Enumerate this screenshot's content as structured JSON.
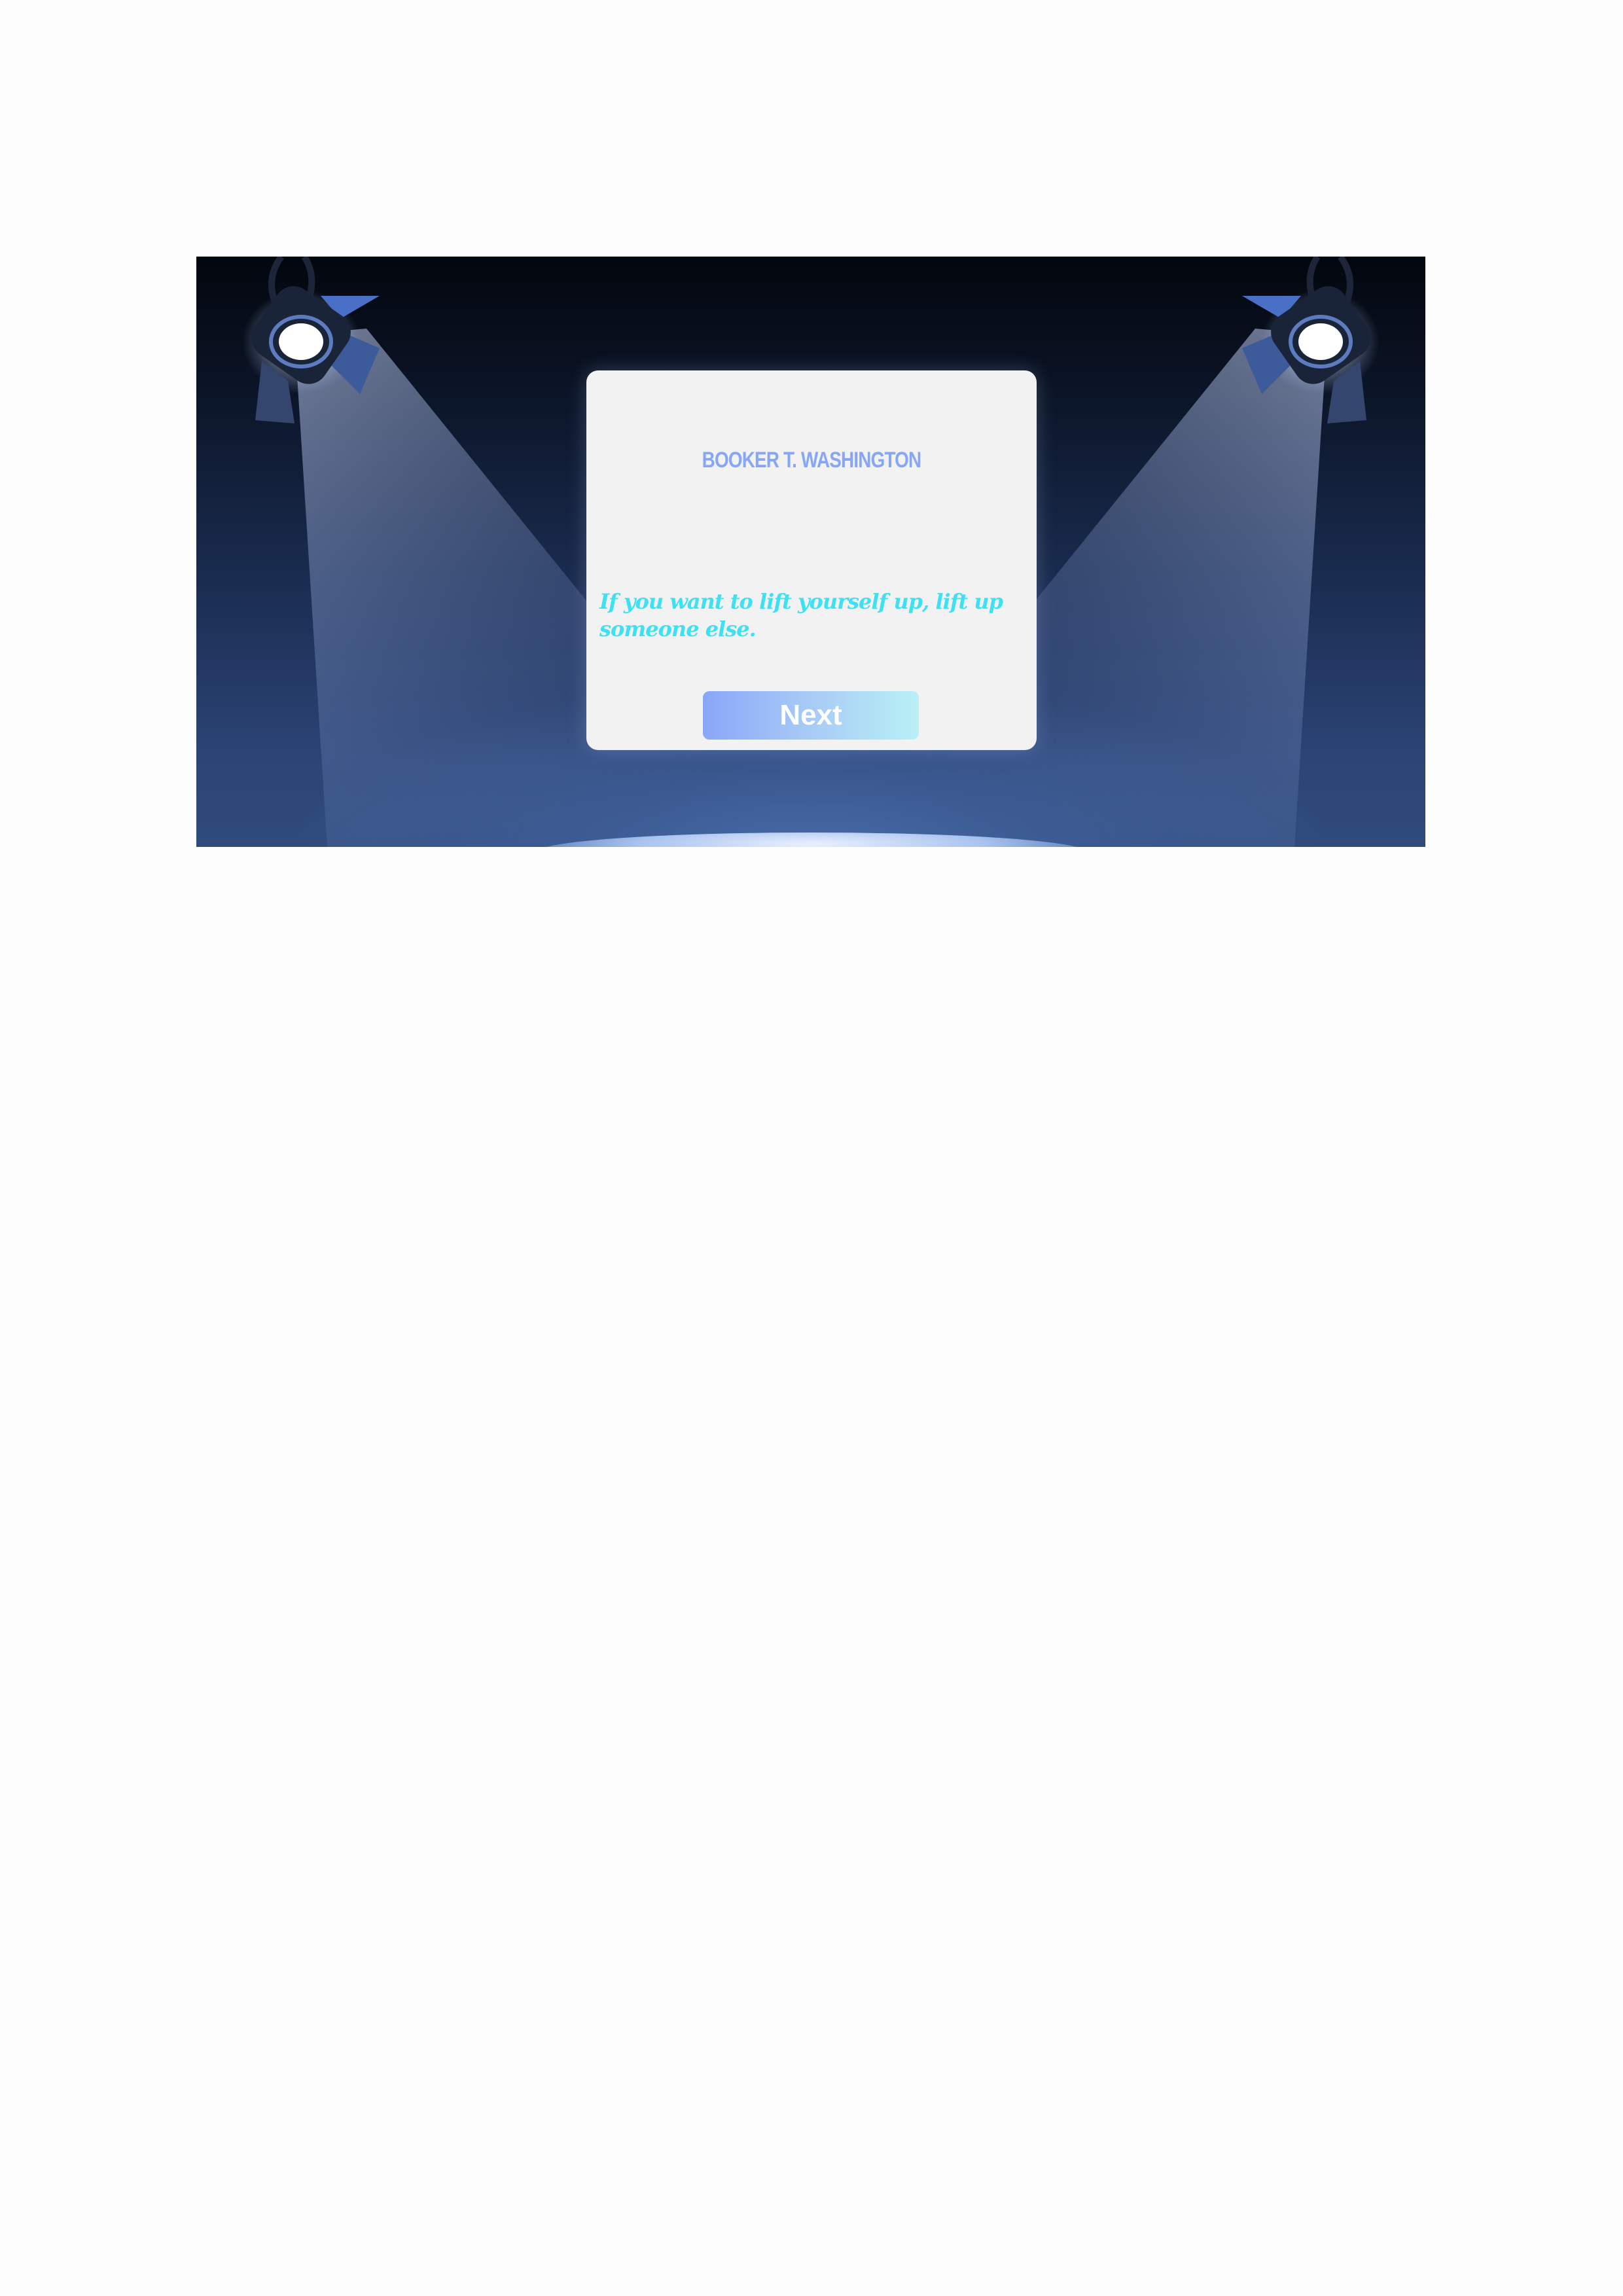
{
  "quote_card": {
    "author": "Booker T. Washington",
    "quote": "If you want to lift yourself up, lift up someone else.",
    "next_label": "Next"
  },
  "colors": {
    "author": "#86a6f7",
    "quote": "#3fe0f2",
    "button_gradient_start": "#8aa6f8",
    "button_gradient_end": "#b9f0f6",
    "card_background": "#f2f2f2",
    "stage_dark": "#03060d",
    "stage_light": "#2f4a7c"
  },
  "icons": {
    "left_light": "spotlight-icon",
    "right_light": "spotlight-icon"
  }
}
